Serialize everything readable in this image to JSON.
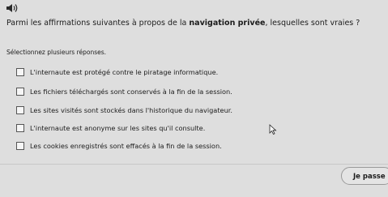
{
  "question": {
    "prefix": "Parmi les affirmations suivantes à propos de la ",
    "emphasis": "navigation privée",
    "suffix": ", lesquelles sont vraies ?"
  },
  "instruction": "Sélectionnez plusieurs réponses.",
  "options": [
    {
      "label": "L'internaute est protégé contre le piratage informatique.",
      "checked": false
    },
    {
      "label": "Les fichiers téléchargés sont conservés à la fin de la session.",
      "checked": false
    },
    {
      "label": "Les sites visités sont stockés dans l'historique du navigateur.",
      "checked": false
    },
    {
      "label": "L'internaute est anonyme sur les sites qu'il consulte.",
      "checked": false
    },
    {
      "label": "Les cookies enregistrés sont effacés à la fin de la session.",
      "checked": false
    }
  ],
  "skip_button": {
    "label": "Je passe"
  },
  "icons": {
    "audio": "speaker-icon",
    "pointer": "mouse-cursor-icon"
  }
}
